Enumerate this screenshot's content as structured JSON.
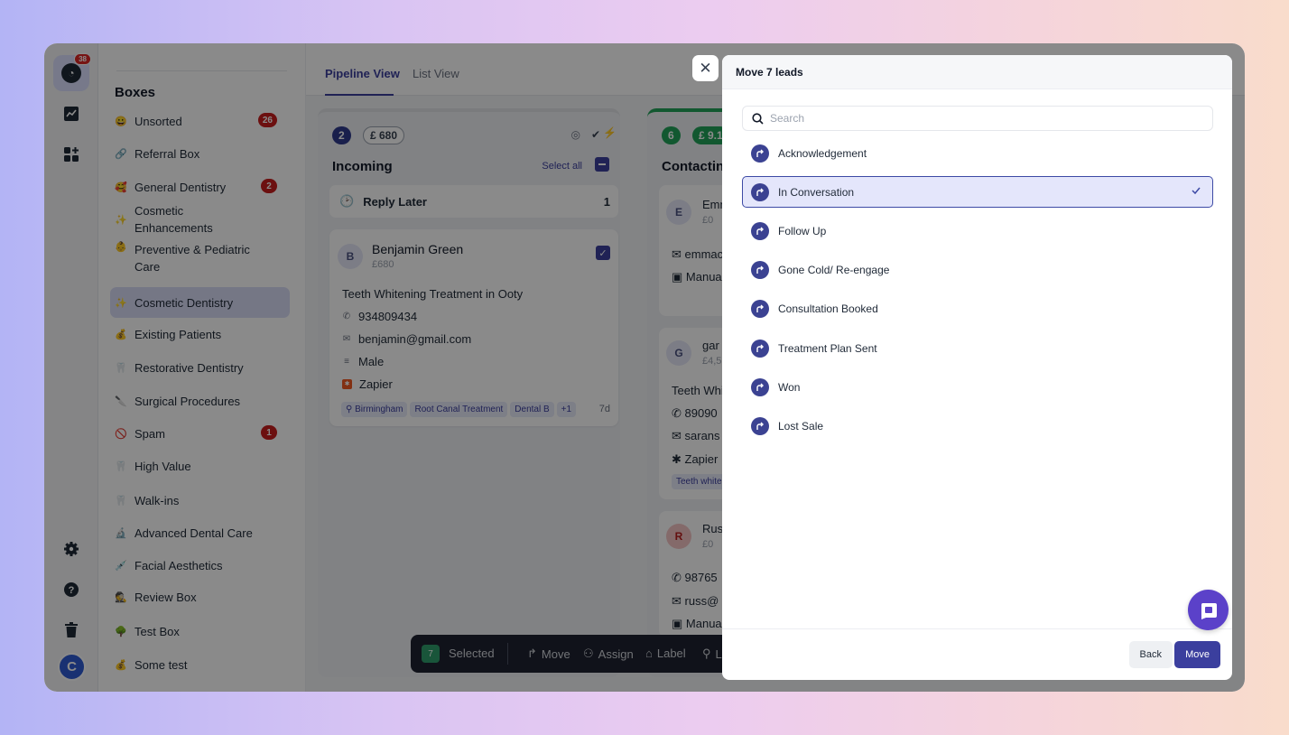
{
  "rail": {
    "logo_badge": "38",
    "avatar_initial": "C",
    "icons": [
      "chart-icon",
      "apps-icon",
      "settings-icon",
      "help-icon",
      "trash-icon"
    ]
  },
  "sidebar": {
    "title": "Boxes",
    "items": [
      {
        "emoji": "😀",
        "label": "Unsorted",
        "count": "26"
      },
      {
        "emoji": "🔗",
        "label": "Referral Box",
        "count": ""
      },
      {
        "emoji": "🥰",
        "label": "General Dentistry",
        "count": "2"
      },
      {
        "emoji": "✨",
        "label": "Cosmetic Enhancements",
        "count": ""
      },
      {
        "emoji": "👶",
        "label": "Preventive & Pediatric Care",
        "count": ""
      },
      {
        "emoji": "✨",
        "label": "Cosmetic Dentistry",
        "count": "",
        "active": true
      },
      {
        "emoji": "💰",
        "label": "Existing Patients",
        "count": ""
      },
      {
        "emoji": "🦷",
        "label": "Restorative Dentistry",
        "count": ""
      },
      {
        "emoji": "🔪",
        "label": "Surgical Procedures",
        "count": ""
      },
      {
        "emoji": "🚫",
        "label": "Spam",
        "count": "1"
      },
      {
        "emoji": "🦷",
        "label": "High Value",
        "count": ""
      },
      {
        "emoji": "🦷",
        "label": "Walk-ins",
        "count": ""
      },
      {
        "emoji": "🔬",
        "label": "Advanced Dental Care",
        "count": ""
      },
      {
        "emoji": "💉",
        "label": "Facial Aesthetics",
        "count": ""
      },
      {
        "emoji": "🕵",
        "label": "Review Box",
        "count": ""
      },
      {
        "emoji": "🌳",
        "label": "Test Box",
        "count": ""
      },
      {
        "emoji": "💰",
        "label": "Some test",
        "count": ""
      }
    ]
  },
  "tabs": {
    "pipeline": "Pipeline View",
    "list": "List View"
  },
  "column_incoming": {
    "count": "2",
    "value": "£ 680",
    "title": "Incoming",
    "select_all": "Select all",
    "reply_later": {
      "label": "Reply Later",
      "count": "1"
    },
    "card": {
      "initial": "B",
      "name": "Benjamin Green",
      "value": "£680",
      "treatment": "Teeth Whitening Treatment in Ooty",
      "phone": "934809434",
      "email": "benjamin@gmail.com",
      "gender": "Male",
      "source": "Zapier",
      "tags": [
        "Birmingham",
        "Root Canal Treatment",
        "Dental B"
      ],
      "more": "+1",
      "age": "7d"
    }
  },
  "column_contacting": {
    "count": "6",
    "value": "£ 9.1",
    "title": "Contactin",
    "cards": [
      {
        "initial": "E",
        "name": "Emm",
        "value": "£0",
        "line1": "emmac",
        "line2": "Manua"
      },
      {
        "initial": "G",
        "name": "gar",
        "value": "£4,5",
        "line0": "Teeth Whi",
        "line1": "89090",
        "line2": "sarans",
        "line3": "Zapier",
        "tag": "Teeth white"
      },
      {
        "initial": "R",
        "name": "Rus",
        "value": "£0",
        "line1": "98765",
        "line2": "russ@",
        "line3": "Manua"
      }
    ]
  },
  "action_bar": {
    "selected_count": "7",
    "selected_label": "Selected",
    "move": "Move",
    "assign": "Assign",
    "label": "Label",
    "location": "L"
  },
  "modal": {
    "title": "Move 7 leads",
    "search_placeholder": "Search",
    "options": [
      {
        "label": "Acknowledgement",
        "selected": false
      },
      {
        "label": "In Conversation",
        "selected": true
      },
      {
        "label": "Follow Up",
        "selected": false
      },
      {
        "label": "Gone Cold/ Re-engage",
        "selected": false
      },
      {
        "label": "Consultation Booked",
        "selected": false
      },
      {
        "label": "Treatment Plan Sent",
        "selected": false
      },
      {
        "label": "Won",
        "selected": false
      },
      {
        "label": "Lost Sale",
        "selected": false
      }
    ],
    "back": "Back",
    "move": "Move"
  },
  "colors": {
    "accent": "#3b3f9e",
    "badge_red": "#c81e1e",
    "contacting_green": "#22a35a",
    "chat_purple": "#5b41c9"
  }
}
